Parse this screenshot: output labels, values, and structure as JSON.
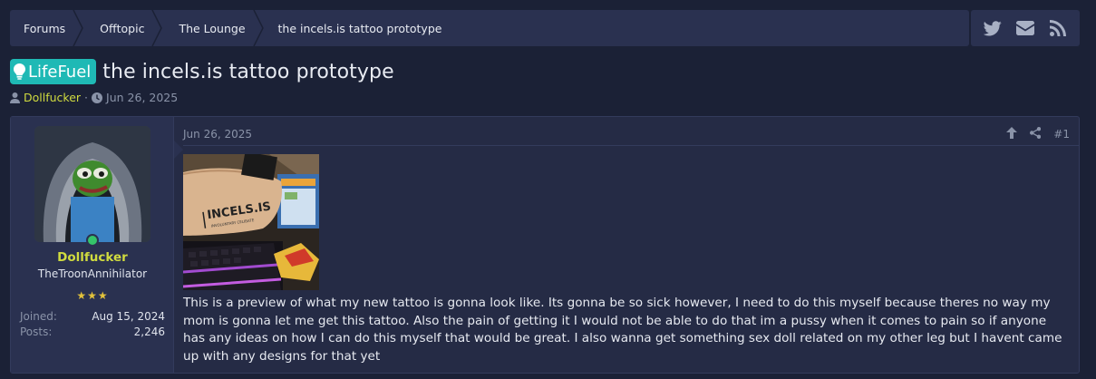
{
  "breadcrumb": {
    "items": [
      {
        "label": "Forums"
      },
      {
        "label": "Offtopic"
      },
      {
        "label": "The Lounge"
      }
    ],
    "current": "the incels.is tattoo prototype"
  },
  "share": {
    "icons": [
      "twitter-icon",
      "email-icon",
      "rss-icon"
    ]
  },
  "thread": {
    "prefix": "LifeFuel",
    "title": "the incels.is tattoo prototype",
    "author": "Dollfucker",
    "separator": "·",
    "date": "Jun 26, 2025"
  },
  "post": {
    "user": {
      "name": "Dollfucker",
      "title": "TheTroonAnnihilator",
      "stars": "★★★",
      "joined_label": "Joined:",
      "joined": "Aug 15, 2024",
      "posts_label": "Posts:",
      "posts": "2,246"
    },
    "date": "Jun 26, 2025",
    "number": "#1",
    "attachment": {
      "arm_text": "INCELS.IS",
      "arm_subtext": "INVOLUNTARY CELIBATE"
    },
    "body": "This is a preview of what my new tattoo is gonna look like. Its gonna be so sick however, I need to do this myself because theres no way my mom is gonna let me get this tattoo. Also the pain of getting it I would not be able to do that im a pussy when it comes to pain so if anyone has any ideas on how I can do this myself that would be great. I also wanna get something sex doll related on my other leg but I havent came up with any designs for that yet"
  },
  "colors": {
    "background": "#1b2136",
    "bar": "#2a3150",
    "prefix": "#1fb9b5",
    "username": "#d0db3f",
    "online": "#35c46a"
  }
}
